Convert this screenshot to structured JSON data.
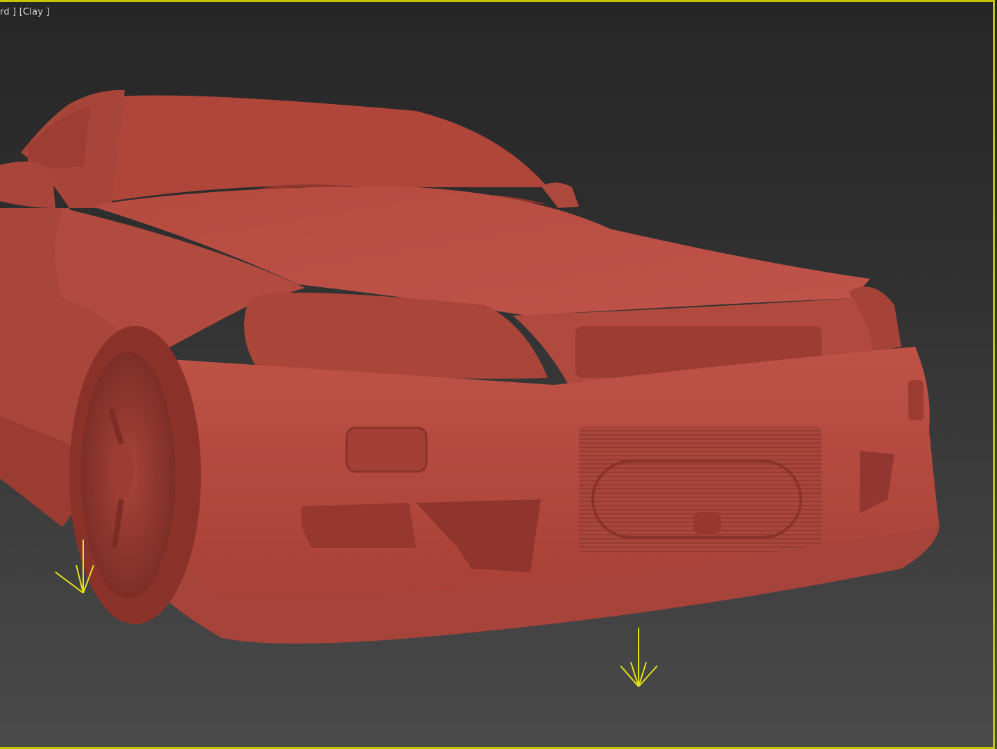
{
  "viewport": {
    "label": "rd ] [Clay ]",
    "border_color": "#c8c400",
    "model_color": "#b5483d",
    "gizmo_color": "#e6e21a"
  }
}
